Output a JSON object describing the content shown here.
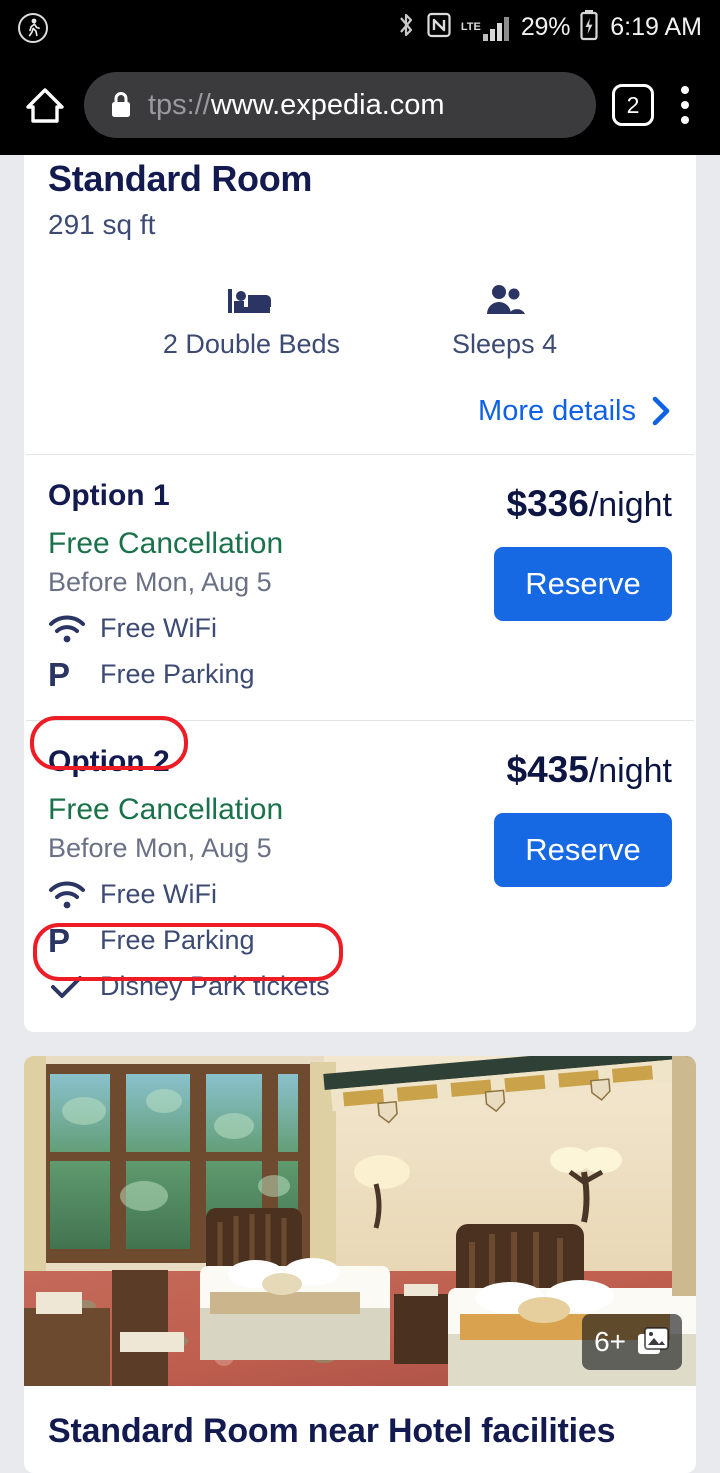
{
  "status_bar": {
    "activity_icon": "walking-person-icon",
    "bluetooth_icon": "bluetooth-icon",
    "nfc_icon": "nfc-icon",
    "network_type": "LTE",
    "signal_icon": "signal-bars-icon",
    "battery_percent": "29%",
    "battery_icon": "battery-charging-icon",
    "time": "6:19 AM"
  },
  "browser": {
    "home_icon": "home-icon",
    "lock_icon": "lock-icon",
    "url_prefix": "tps://",
    "url_domain": "www.expedia.com",
    "tab_count": "2",
    "menu_icon": "overflow-menu-icon"
  },
  "room": {
    "title": "Standard Room",
    "size": "291 sq ft",
    "facts": [
      {
        "icon": "bed-icon",
        "label": "2 Double Beds"
      },
      {
        "icon": "people-icon",
        "label": "Sleeps 4"
      }
    ],
    "more_details_label": "More details",
    "more_details_icon": "chevron-right-icon"
  },
  "options": [
    {
      "name": "Option 1",
      "cancellation": "Free Cancellation",
      "cancellation_deadline": "Before Mon, Aug 5",
      "amenities": [
        {
          "icon": "wifi-icon",
          "label": "Free WiFi"
        },
        {
          "icon": "parking-icon",
          "label": "Free Parking"
        }
      ],
      "price_amount": "$336",
      "price_unit": "/night",
      "reserve_label": "Reserve"
    },
    {
      "name": "Option 2",
      "cancellation": "Free Cancellation",
      "cancellation_deadline": "Before Mon, Aug 5",
      "amenities": [
        {
          "icon": "wifi-icon",
          "label": "Free WiFi"
        },
        {
          "icon": "parking-icon",
          "label": "Free Parking"
        },
        {
          "icon": "check-icon",
          "label": "Disney Park tickets"
        }
      ],
      "price_amount": "$435",
      "price_unit": "/night",
      "reserve_label": "Reserve"
    }
  ],
  "annotations": {
    "color": "#ee1c25",
    "targets": [
      "Option 2",
      "Disney Park tickets"
    ]
  },
  "photo_card": {
    "badge_count": "6+",
    "badge_icon": "photo-gallery-icon",
    "caption": "Standard Room near Hotel facilities"
  },
  "colors": {
    "accent_blue": "#1668e3",
    "link_blue": "#0f62e6",
    "navy": "#121a4f",
    "green": "#19724a",
    "muted": "#6a7186",
    "page_bg": "#e9eaee",
    "annotation_red": "#ee1c25"
  }
}
